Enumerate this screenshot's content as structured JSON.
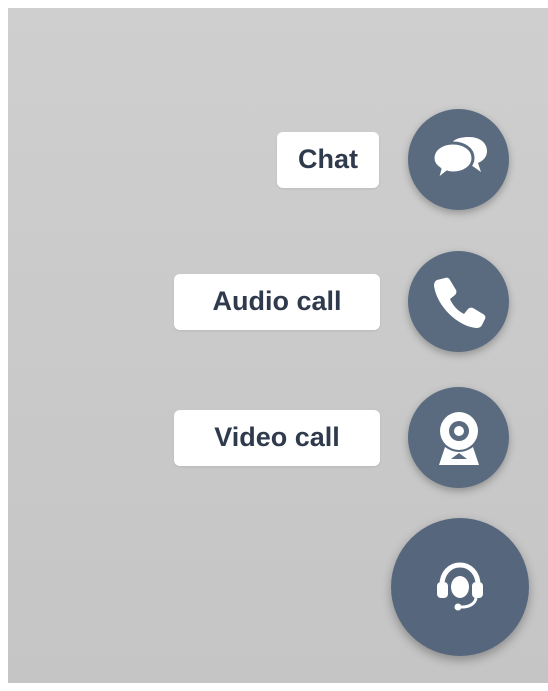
{
  "actions": {
    "chat": {
      "label": "Chat",
      "icon": "chat-bubbles-icon"
    },
    "audio": {
      "label": "Audio call",
      "icon": "phone-icon"
    },
    "video": {
      "label": "Video call",
      "icon": "webcam-icon"
    }
  },
  "main_button": {
    "icon": "headset-icon"
  },
  "colors": {
    "background": "#c9c9c9",
    "button": "#5a6b80",
    "label_bg": "#ffffff",
    "label_text": "#2f3b4d"
  }
}
